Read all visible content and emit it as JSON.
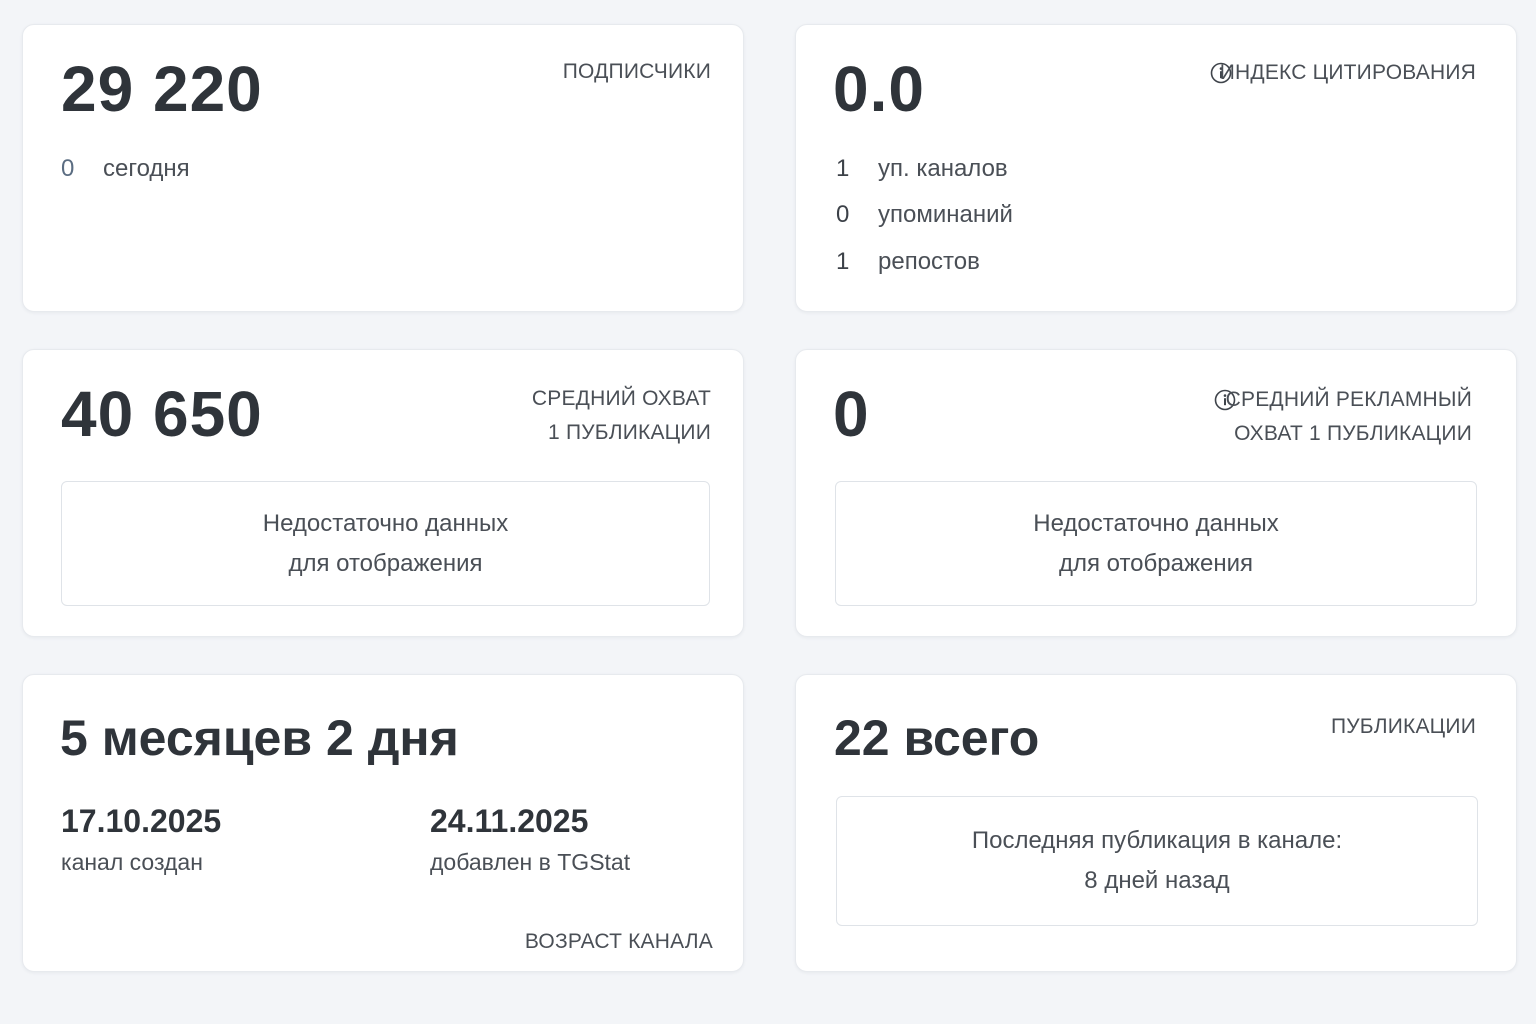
{
  "subscribers": {
    "value": "29 220",
    "caption": "ПОДПИСЧИКИ",
    "today_count": "0",
    "today_label": "сегодня"
  },
  "citation": {
    "value": "0.0",
    "caption": "ИНДЕКС ЦИТИРОВАНИЯ",
    "icon": "info-icon",
    "rows": [
      {
        "count": "1",
        "label": "уп. каналов"
      },
      {
        "count": "0",
        "label": "упоминаний"
      },
      {
        "count": "1",
        "label": "репостов"
      }
    ]
  },
  "avg_reach": {
    "value": "40 650",
    "caption_line1": "СРЕДНИЙ ОХВАТ",
    "caption_line2": "1 ПУБЛИКАЦИИ",
    "empty_line1": "Недостаточно данных",
    "empty_line2": "для отображения"
  },
  "avg_ad_reach": {
    "value": "0",
    "caption_line1": "СРЕДНИЙ РЕКЛАМНЫЙ",
    "caption_line2": "ОХВАТ 1 ПУБЛИКАЦИИ",
    "icon": "info-icon",
    "empty_line1": "Недостаточно данных",
    "empty_line2": "для отображения"
  },
  "channel_age": {
    "value": "5 месяцев 2 дня",
    "created_date": "17.10.2025",
    "created_label": "канал создан",
    "added_date": "24.11.2025",
    "added_label": "добавлен в TGStat",
    "caption": "ВОЗРАСТ КАНАЛА"
  },
  "publications": {
    "value": "22 всего",
    "caption": "ПУБЛИКАЦИИ",
    "last_line1": "Последняя публикация в канале:",
    "last_line2": "8 дней назад"
  },
  "colors": {
    "page_bg": "#f3f5f8",
    "card_bg": "#ffffff",
    "muted_number": "#5b6d82"
  }
}
